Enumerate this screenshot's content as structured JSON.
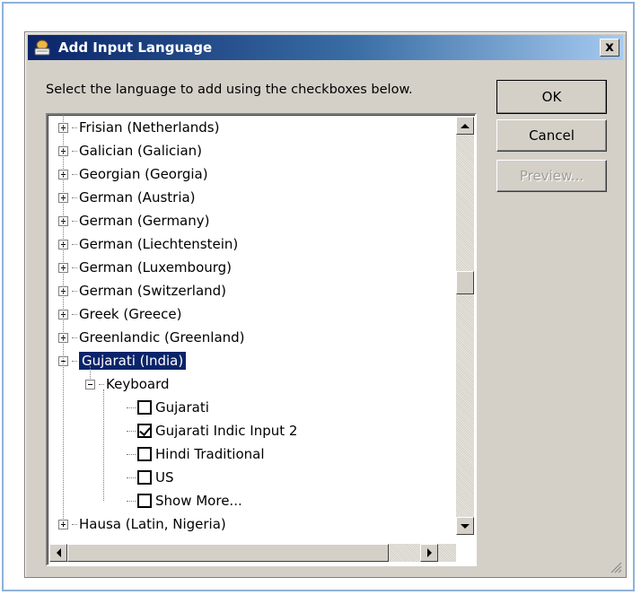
{
  "dialog": {
    "title": "Add Input Language",
    "close_glyph": "x",
    "instruction": "Select the language to add using the checkboxes below.",
    "buttons": {
      "ok": "OK",
      "cancel": "Cancel",
      "preview": "Preview..."
    }
  },
  "tree": {
    "languages_top": [
      "Frisian (Netherlands)",
      "Galician (Galician)",
      "Georgian (Georgia)",
      "German (Austria)",
      "German (Germany)",
      "German (Liechtenstein)",
      "German (Luxembourg)",
      "German (Switzerland)",
      "Greek (Greece)",
      "Greenlandic (Greenland)"
    ],
    "selected_language": "Gujarati (India)",
    "group_label": "Keyboard",
    "keyboards": [
      {
        "label": "Gujarati",
        "checked": false
      },
      {
        "label": "Gujarati Indic Input 2",
        "checked": true
      },
      {
        "label": "Hindi Traditional",
        "checked": false
      },
      {
        "label": "US",
        "checked": false
      },
      {
        "label": "Show More...",
        "checked": false
      }
    ],
    "languages_bottom": [
      "Hausa (Latin, Nigeria)"
    ]
  },
  "colors": {
    "title_gradient_start": "#0a246a",
    "selection": "#0a246a",
    "dialog_face": "#d4d0c8"
  },
  "icons": {
    "title": "keyboard-globe-icon",
    "expand": "plus-icon",
    "collapse": "minus-icon"
  }
}
